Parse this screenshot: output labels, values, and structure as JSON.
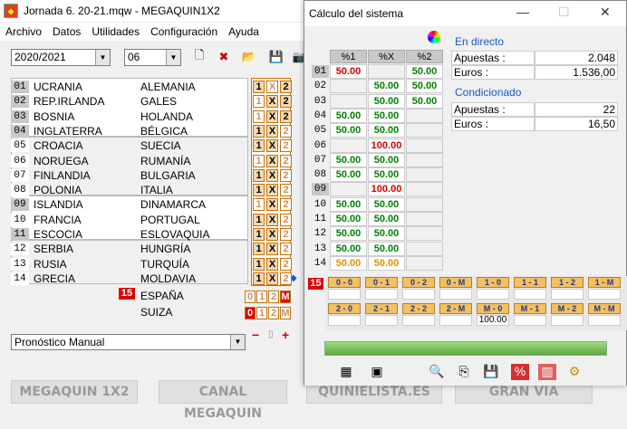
{
  "main": {
    "title": "Jornada 6. 20-21.mqw - MEGAQUIN1X2",
    "menu": [
      "Archivo",
      "Datos",
      "Utilidades",
      "Configuración",
      "Ayuda"
    ],
    "season": "2020/2021",
    "jornada": "06",
    "matches": [
      {
        "n": "01",
        "home": "UCRANIA",
        "away": "ALEMANIA",
        "signs": [
          "1",
          "X",
          "2"
        ],
        "on": [
          true,
          false,
          true
        ]
      },
      {
        "n": "02",
        "home": "REP.IRLANDA",
        "away": "GALES",
        "signs": [
          "1",
          "X",
          "2"
        ],
        "on": [
          false,
          true,
          true
        ]
      },
      {
        "n": "03",
        "home": "BOSNIA",
        "away": "HOLANDA",
        "signs": [
          "1",
          "X",
          "2"
        ],
        "on": [
          false,
          true,
          true
        ]
      },
      {
        "n": "04",
        "home": "INGLATERRA",
        "away": "BÉLGICA",
        "signs": [
          "1",
          "X",
          "2"
        ],
        "on": [
          true,
          true,
          false
        ]
      },
      {
        "n": "05",
        "home": "CROACIA",
        "away": "SUECIA",
        "signs": [
          "1",
          "X",
          "2"
        ],
        "on": [
          true,
          true,
          false
        ]
      },
      {
        "n": "06",
        "home": "NORUEGA",
        "away": "RUMANÍA",
        "signs": [
          "1",
          "X",
          "2"
        ],
        "on": [
          false,
          true,
          false
        ]
      },
      {
        "n": "07",
        "home": "FINLANDIA",
        "away": "BULGARIA",
        "signs": [
          "1",
          "X",
          "2"
        ],
        "on": [
          true,
          true,
          false
        ]
      },
      {
        "n": "08",
        "home": "POLONIA",
        "away": "ITALIA",
        "signs": [
          "1",
          "X",
          "2"
        ],
        "on": [
          true,
          true,
          false
        ]
      },
      {
        "n": "09",
        "home": "ISLANDIA",
        "away": "DINAMARCA",
        "signs": [
          "1",
          "X",
          "2"
        ],
        "on": [
          false,
          true,
          false
        ]
      },
      {
        "n": "10",
        "home": "FRANCIA",
        "away": "PORTUGAL",
        "signs": [
          "1",
          "X",
          "2"
        ],
        "on": [
          true,
          true,
          false
        ]
      },
      {
        "n": "11",
        "home": "ESCOCIA",
        "away": "ESLOVAQUIA",
        "signs": [
          "1",
          "X",
          "2"
        ],
        "on": [
          true,
          true,
          false
        ]
      },
      {
        "n": "12",
        "home": "SERBIA",
        "away": "HUNGRÍA",
        "signs": [
          "1",
          "X",
          "2"
        ],
        "on": [
          true,
          true,
          false
        ]
      },
      {
        "n": "13",
        "home": "RUSIA",
        "away": "TURQUÍA",
        "signs": [
          "1",
          "X",
          "2"
        ],
        "on": [
          true,
          true,
          false
        ]
      },
      {
        "n": "14",
        "home": "GRECIA",
        "away": "MOLDAVIA",
        "signs": [
          "1",
          "X",
          "2"
        ],
        "on": [
          true,
          true,
          false
        ]
      }
    ],
    "pleno": {
      "n": "15",
      "home": "ESPAÑA",
      "away": "SUIZA",
      "home_signs": [
        "0",
        "1",
        "2",
        "M"
      ],
      "away_signs": [
        "0",
        "1",
        "2",
        "M"
      ]
    },
    "pronostico": "Pronóstico Manual",
    "logos": [
      "MEGAQUIN 1X2",
      "CANAL MEGAQUIN",
      "QUINIELISTA.ES",
      "GRAN VIA"
    ]
  },
  "window": {
    "title": "Cálculo del sistema",
    "headers": [
      "%1",
      "%X",
      "%2"
    ],
    "rows": [
      {
        "n": "01",
        "v": [
          "50.00",
          "",
          "50.00"
        ],
        "c": [
          "red",
          "",
          "grn"
        ]
      },
      {
        "n": "02",
        "v": [
          "",
          "50.00",
          "50.00"
        ],
        "c": [
          "",
          "grn",
          "grn"
        ]
      },
      {
        "n": "03",
        "v": [
          "",
          "50.00",
          "50.00"
        ],
        "c": [
          "",
          "grn",
          "grn"
        ]
      },
      {
        "n": "04",
        "v": [
          "50.00",
          "50.00",
          ""
        ],
        "c": [
          "grn",
          "grn",
          ""
        ]
      },
      {
        "n": "05",
        "v": [
          "50.00",
          "50.00",
          ""
        ],
        "c": [
          "grn",
          "grn",
          ""
        ]
      },
      {
        "n": "06",
        "v": [
          "",
          "100.00",
          ""
        ],
        "c": [
          "",
          "red",
          ""
        ]
      },
      {
        "n": "07",
        "v": [
          "50.00",
          "50.00",
          ""
        ],
        "c": [
          "grn",
          "grn",
          ""
        ]
      },
      {
        "n": "08",
        "v": [
          "50.00",
          "50.00",
          ""
        ],
        "c": [
          "grn",
          "grn",
          ""
        ]
      },
      {
        "n": "09",
        "v": [
          "",
          "100.00",
          ""
        ],
        "c": [
          "",
          "red",
          ""
        ]
      },
      {
        "n": "10",
        "v": [
          "50.00",
          "50.00",
          ""
        ],
        "c": [
          "grn",
          "grn",
          ""
        ]
      },
      {
        "n": "11",
        "v": [
          "50.00",
          "50.00",
          ""
        ],
        "c": [
          "grn",
          "grn",
          ""
        ]
      },
      {
        "n": "12",
        "v": [
          "50.00",
          "50.00",
          ""
        ],
        "c": [
          "grn",
          "grn",
          ""
        ]
      },
      {
        "n": "13",
        "v": [
          "50.00",
          "50.00",
          ""
        ],
        "c": [
          "grn",
          "grn",
          ""
        ]
      },
      {
        "n": "14",
        "v": [
          "50.00",
          "50.00",
          ""
        ],
        "c": [
          "org",
          "org",
          ""
        ]
      }
    ],
    "directo": {
      "label": "En directo",
      "apuestas_label": "Apuestas :",
      "apuestas": "2.048",
      "euros_label": "Euros :",
      "euros": "1.536,00"
    },
    "condicionado": {
      "label": "Condicionado",
      "apuestas_label": "Apuestas :",
      "apuestas": "22",
      "euros_label": "Euros :",
      "euros": "16,50"
    },
    "pleno_n": "15",
    "results_row1": [
      "0 - 0",
      "0 - 1",
      "0 - 2",
      "0 - M",
      "1 - 0",
      "1 - 1",
      "1 - 2",
      "1 - M"
    ],
    "results_row2": [
      "2 - 0",
      "2 - 1",
      "2 - 2",
      "2 - M",
      "M - 0",
      "M - 1",
      "M - 2",
      "M - M"
    ],
    "results_val2": [
      "",
      "",
      "",
      "",
      "100.00",
      "",
      "",
      ""
    ]
  }
}
